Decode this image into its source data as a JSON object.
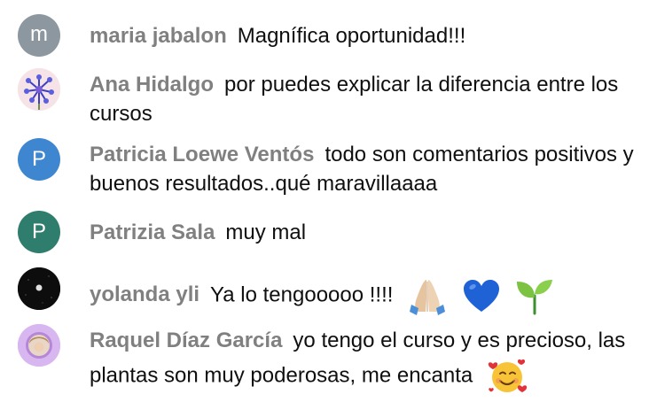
{
  "messages": [
    {
      "author": "maria jabalon",
      "text": "Magnífica oportunidad!!!",
      "avatar": {
        "kind": "letter",
        "letter": "m",
        "color": "#8c97a0"
      }
    },
    {
      "author": "Ana Hidalgo",
      "text": "por puedes explicar la diferencia entre los cursos",
      "avatar": {
        "kind": "image",
        "icon": "blue-flowers-avatar"
      }
    },
    {
      "author": "Patricia Loewe Ventós",
      "text": "todo son comentarios positivos y buenos resultados..qué maravillaaaa",
      "avatar": {
        "kind": "letter",
        "letter": "P",
        "color": "#3e87d0"
      }
    },
    {
      "author": "Patrizia Sala",
      "text": "muy mal",
      "avatar": {
        "kind": "letter",
        "letter": "P",
        "color": "#2f7d6d"
      }
    },
    {
      "author": "yolanda yli",
      "text": "Ya lo tengooooo !!!!",
      "avatar": {
        "kind": "image",
        "icon": "dark-moon-avatar"
      },
      "emojis": [
        "folded-hands-emoji",
        "blue-heart-emoji",
        "seedling-emoji"
      ]
    },
    {
      "author": "Raquel Díaz García",
      "text": "yo tengo el curso y es precioso, las plantas son muy poderosas, me encanta",
      "avatar": {
        "kind": "image",
        "icon": "purple-ring-portrait-avatar"
      },
      "emojis": [
        "smiling-face-with-hearts-emoji"
      ]
    }
  ]
}
